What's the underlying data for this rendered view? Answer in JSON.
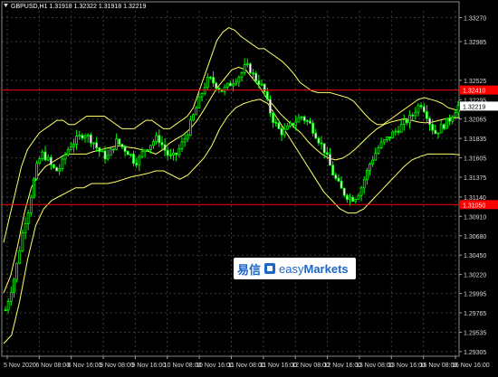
{
  "chart_data": {
    "type": "candlestick",
    "info": "GBPUSD,H1  1.31918 1.32322 1.31918 1.32219",
    "indicator": "Bollinger Bands",
    "ylim": [
      1.2925,
      1.3335
    ],
    "price_ticks": [
      "1.33270",
      "1.32985",
      "1.32525",
      "1.32295",
      "1.32065",
      "1.31835",
      "1.31605",
      "1.31375",
      "1.31140",
      "1.30910",
      "1.30680",
      "1.30450",
      "1.30220",
      "1.29995",
      "1.29765",
      "1.29535",
      "1.29305"
    ],
    "time_labels": [
      "5 Nov 2020",
      "6 Nov 08:00",
      "6 Nov 16:00",
      "9 Nov 08:00",
      "9 Nov 16:00",
      "10 Nov 08:00",
      "10 Nov 16:00",
      "11 Nov 08:00",
      "11 Nov 16:00",
      "12 Nov 08:00",
      "12 Nov 16:00",
      "13 Nov 08:00",
      "13 Nov 16:00",
      "16 Nov 08:00",
      "16 Nov 16:00"
    ],
    "levels": [
      {
        "value": 1.3241,
        "label": "1.32410",
        "color": "#ff0000"
      },
      {
        "value": 1.3105,
        "label": "1.31050",
        "color": "#ff0000"
      }
    ],
    "current_price": {
      "value": 1.32219,
      "label": "1.32219"
    },
    "candles_up_color": "#00ff00",
    "band_color": "#ffff66",
    "close_path": [
      1.298,
      1.3,
      1.302,
      1.305,
      1.308,
      1.31,
      1.313,
      1.3155,
      1.3165,
      1.316,
      1.315,
      1.3145,
      1.315,
      1.3165,
      1.3175,
      1.318,
      1.3185,
      1.319,
      1.3185,
      1.318,
      1.317,
      1.3165,
      1.316,
      1.317,
      1.318,
      1.3175,
      1.317,
      1.3165,
      1.3155,
      1.316,
      1.317,
      1.3175,
      1.318,
      1.3185,
      1.3175,
      1.3165,
      1.316,
      1.3165,
      1.3175,
      1.3185,
      1.32,
      1.3215,
      1.323,
      1.3245,
      1.3255,
      1.325,
      1.3245,
      1.324,
      1.3245,
      1.325,
      1.3255,
      1.326,
      1.327,
      1.3265,
      1.3255,
      1.325,
      1.324,
      1.322,
      1.3205,
      1.3195,
      1.319,
      1.3195,
      1.32,
      1.3205,
      1.321,
      1.3205,
      1.32,
      1.319,
      1.318,
      1.317,
      1.3155,
      1.314,
      1.313,
      1.312,
      1.3115,
      1.3112,
      1.3115,
      1.3125,
      1.314,
      1.3155,
      1.3165,
      1.3175,
      1.318,
      1.3185,
      1.319,
      1.3195,
      1.32,
      1.3205,
      1.321,
      1.322,
      1.3225,
      1.3215,
      1.32,
      1.319,
      1.3195,
      1.32,
      1.3205,
      1.3215,
      1.3222
    ],
    "upper_band_path": [
      1.306,
      1.309,
      1.312,
      1.315,
      1.317,
      1.318,
      1.319,
      1.3195,
      1.32,
      1.3205,
      1.3205,
      1.32,
      1.32,
      1.3205,
      1.321,
      1.321,
      1.321,
      1.321,
      1.3205,
      1.32,
      1.3195,
      1.3195,
      1.3195,
      1.32,
      1.3205,
      1.3205,
      1.32,
      1.3195,
      1.3195,
      1.32,
      1.3205,
      1.321,
      1.322,
      1.324,
      1.326,
      1.328,
      1.33,
      1.331,
      1.3315,
      1.3312,
      1.3305,
      1.33,
      1.3295,
      1.329,
      1.329,
      1.3285,
      1.328,
      1.3275,
      1.3268,
      1.326,
      1.325,
      1.3245,
      1.324,
      1.3238,
      1.3238,
      1.3238,
      1.3236,
      1.3234,
      1.3232,
      1.3228,
      1.322,
      1.3212,
      1.3205,
      1.32,
      1.32,
      1.3205,
      1.321,
      1.3215,
      1.322,
      1.3225,
      1.323,
      1.3232,
      1.323,
      1.3228,
      1.3225,
      1.322,
      1.3218,
      1.3216
    ],
    "lower_band_path": [
      1.294,
      1.295,
      1.299,
      1.304,
      1.308,
      1.31,
      1.311,
      1.3115,
      1.312,
      1.3125,
      1.3125,
      1.313,
      1.313,
      1.313,
      1.3132,
      1.3135,
      1.3138,
      1.314,
      1.3142,
      1.3145,
      1.3145,
      1.314,
      1.3135,
      1.314,
      1.315,
      1.316,
      1.3175,
      1.3195,
      1.321,
      1.322,
      1.3225,
      1.3228,
      1.323,
      1.3225,
      1.321,
      1.3195,
      1.318,
      1.3165,
      1.315,
      1.3135,
      1.312,
      1.311,
      1.31,
      1.3095,
      1.3095,
      1.31,
      1.311,
      1.312,
      1.313,
      1.314,
      1.315,
      1.3158,
      1.3162,
      1.3165,
      1.3165,
      1.3165,
      1.3165,
      1.3164
    ],
    "mid_band_path": [
      1.3,
      1.302,
      1.3055,
      1.3095,
      1.3125,
      1.314,
      1.315,
      1.3155,
      1.316,
      1.3165,
      1.3165,
      1.3165,
      1.3165,
      1.3168,
      1.317,
      1.3172,
      1.3174,
      1.3175,
      1.3173,
      1.3172,
      1.317,
      1.3168,
      1.3165,
      1.317,
      1.3178,
      1.3183,
      1.3188,
      1.3195,
      1.3205,
      1.3218,
      1.3232,
      1.3245,
      1.3255,
      1.3265,
      1.3268,
      1.3265,
      1.3255,
      1.3245,
      1.3232,
      1.3223,
      1.3213,
      1.3205,
      1.3197,
      1.319,
      1.318,
      1.3172,
      1.3165,
      1.316,
      1.3158,
      1.316,
      1.3165,
      1.3172,
      1.318,
      1.3188,
      1.3195,
      1.32,
      1.3203,
      1.3205,
      1.3207,
      1.3205,
      1.3203,
      1.3202,
      1.3203,
      1.3205,
      1.3207,
      1.3208,
      1.3208
    ]
  },
  "watermark": {
    "chinese": "易信",
    "brand_prefix": "easy",
    "brand_suffix": "Markets",
    "color": "#1a66c9"
  }
}
